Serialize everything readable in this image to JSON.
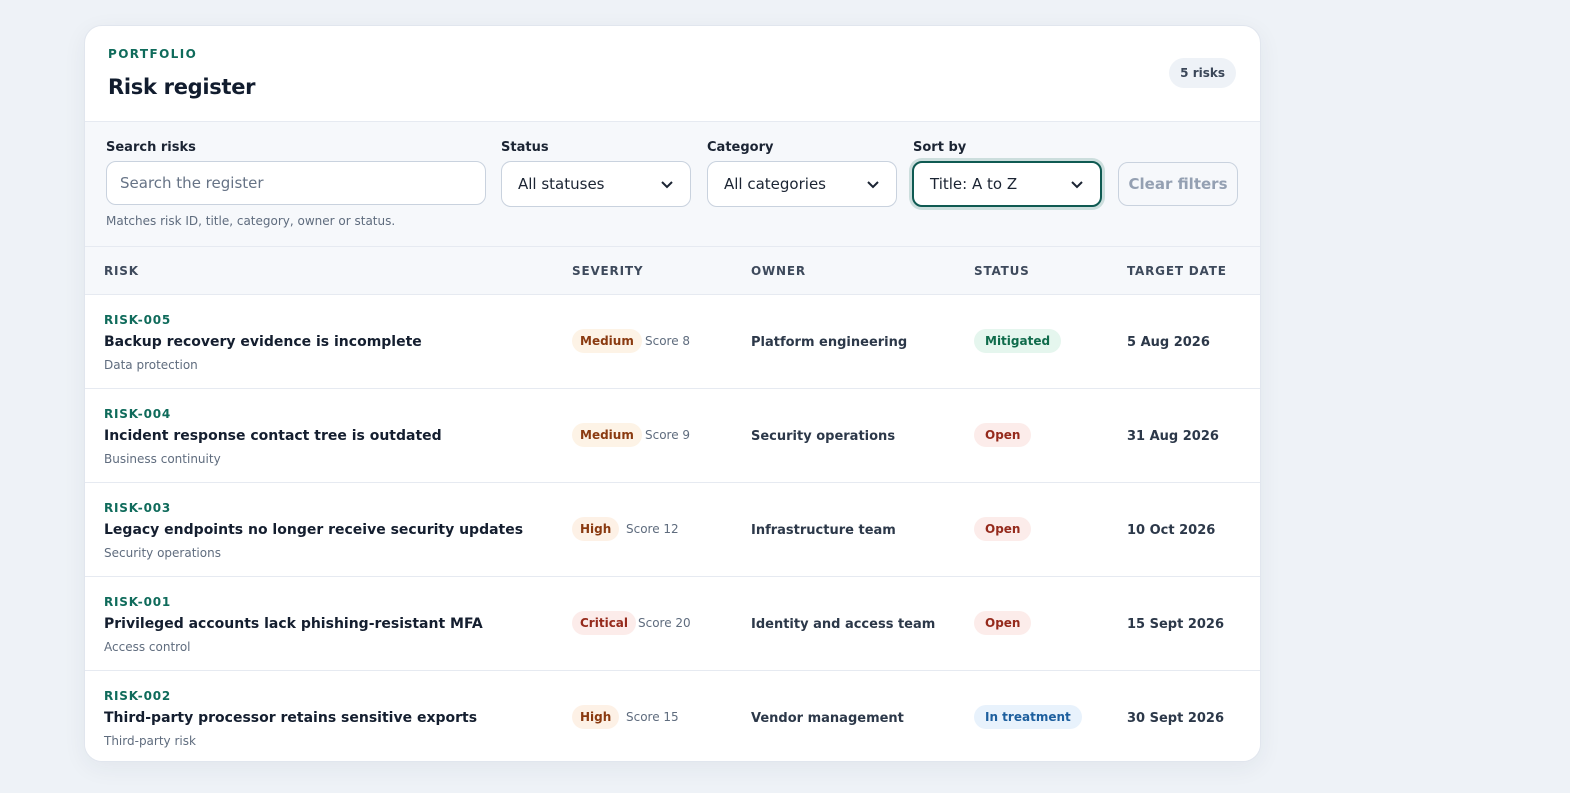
{
  "header": {
    "eyebrow": "PORTFOLIO",
    "title": "Risk register",
    "count": "5 risks"
  },
  "filters": {
    "search_label": "Search risks",
    "search_placeholder": "Search the register",
    "search_value": "",
    "search_hint": "Matches risk ID, title, category, owner or status.",
    "status_label": "Status",
    "status_value": "All statuses",
    "category_label": "Category",
    "category_value": "All categories",
    "sort_label": "Sort by",
    "sort_value": "Title: A to Z",
    "clear_label": "Clear filters"
  },
  "table": {
    "columns": [
      "RISK",
      "SEVERITY",
      "OWNER",
      "STATUS",
      "TARGET DATE"
    ],
    "rows": [
      {
        "id": "RISK-005",
        "title": "Backup recovery evidence is incomplete",
        "category": "Data protection",
        "severity": "Medium",
        "score": "Score 8",
        "owner": "Platform engineering",
        "status": "Mitigated",
        "target": "5 Aug 2026"
      },
      {
        "id": "RISK-004",
        "title": "Incident response contact tree is outdated",
        "category": "Business continuity",
        "severity": "Medium",
        "score": "Score 9",
        "owner": "Security operations",
        "status": "Open",
        "target": "31 Aug 2026"
      },
      {
        "id": "RISK-003",
        "title": "Legacy endpoints no longer receive security updates",
        "category": "Security operations",
        "severity": "High",
        "score": "Score 12",
        "owner": "Infrastructure team",
        "status": "Open",
        "target": "10 Oct 2026"
      },
      {
        "id": "RISK-001",
        "title": "Privileged accounts lack phishing-resistant MFA",
        "category": "Access control",
        "severity": "Critical",
        "score": "Score 20",
        "owner": "Identity and access team",
        "status": "Open",
        "target": "15 Sept 2026"
      },
      {
        "id": "RISK-002",
        "title": "Third-party processor retains sensitive exports",
        "category": "Third-party risk",
        "severity": "High",
        "score": "Score 15",
        "owner": "Vendor management",
        "status": "In treatment",
        "target": "30 Sept 2026"
      }
    ]
  },
  "colors": {
    "accent": "#0f6b5b",
    "page_background": "#eef2f7"
  }
}
